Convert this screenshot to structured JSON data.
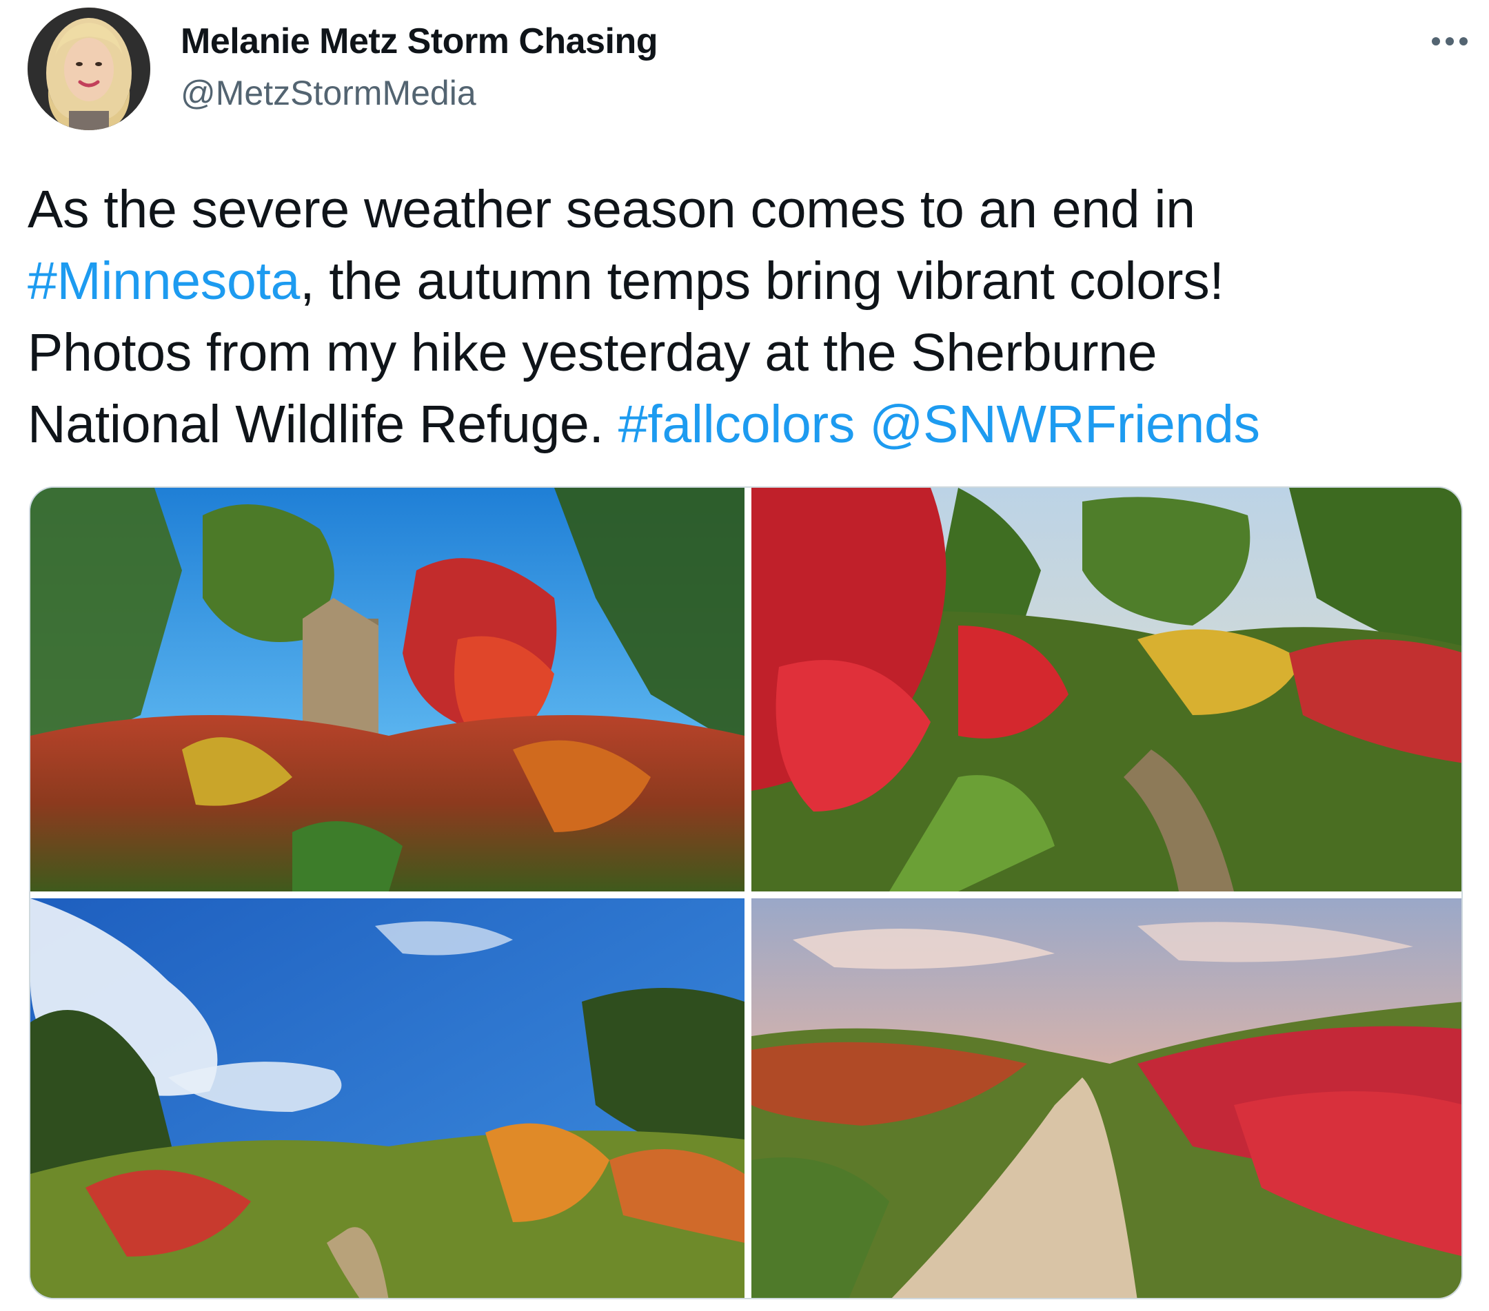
{
  "author": {
    "display_name": "Melanie Metz Storm Chasing",
    "handle": "@MetzStormMedia",
    "avatar_icon": "profile-photo"
  },
  "more_icon": "more-options-icon",
  "tweet": {
    "line1": "As the severe weather season comes to an end in",
    "hashtag_minnesota": "#Minnesota",
    "line2_rest": ", the autumn temps bring vibrant colors!",
    "line3": "Photos from my hike yesterday at the Sherburne",
    "line4_start": "National Wildlife Refuge. ",
    "hashtag_fallcolors": "#fallcolors",
    "mention": "@SNWRFriends"
  },
  "colors": {
    "link": "#1d9bf0",
    "text": "#0f1419",
    "secondary_text": "#536471",
    "border": "#cfd9de"
  },
  "media": {
    "count": 4,
    "photos": [
      "autumn-forest-stump-photo",
      "sumac-trail-photo",
      "blue-sky-trail-photo",
      "sunset-sand-trail-photo"
    ]
  }
}
